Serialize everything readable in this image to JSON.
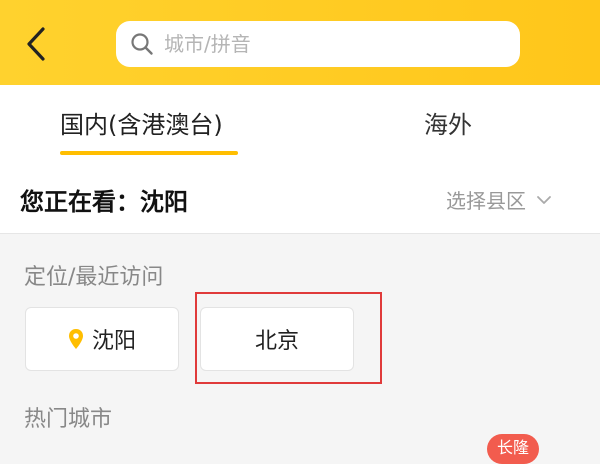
{
  "header": {
    "back_icon": "chevron-left-icon",
    "search": {
      "placeholder": "城市/拼音",
      "value": "",
      "icon": "search-icon"
    },
    "colors": {
      "background": "#ffc91f"
    }
  },
  "tabs": [
    {
      "label": "国内(含港澳台)",
      "active": true
    },
    {
      "label": "海外",
      "active": false
    }
  ],
  "viewing": {
    "label": "您正在看：沈阳",
    "district_select": "选择县区",
    "district_icon": "chevron-down-icon"
  },
  "recent": {
    "title": "定位/最近访问",
    "cities": [
      {
        "label": "沈阳",
        "icon": "location-pin-icon"
      },
      {
        "label": "北京"
      }
    ],
    "highlight_color": "#e03a3a"
  },
  "hot": {
    "title": "热门城市",
    "badge": "长隆",
    "badge_color": "#f25c4e"
  }
}
